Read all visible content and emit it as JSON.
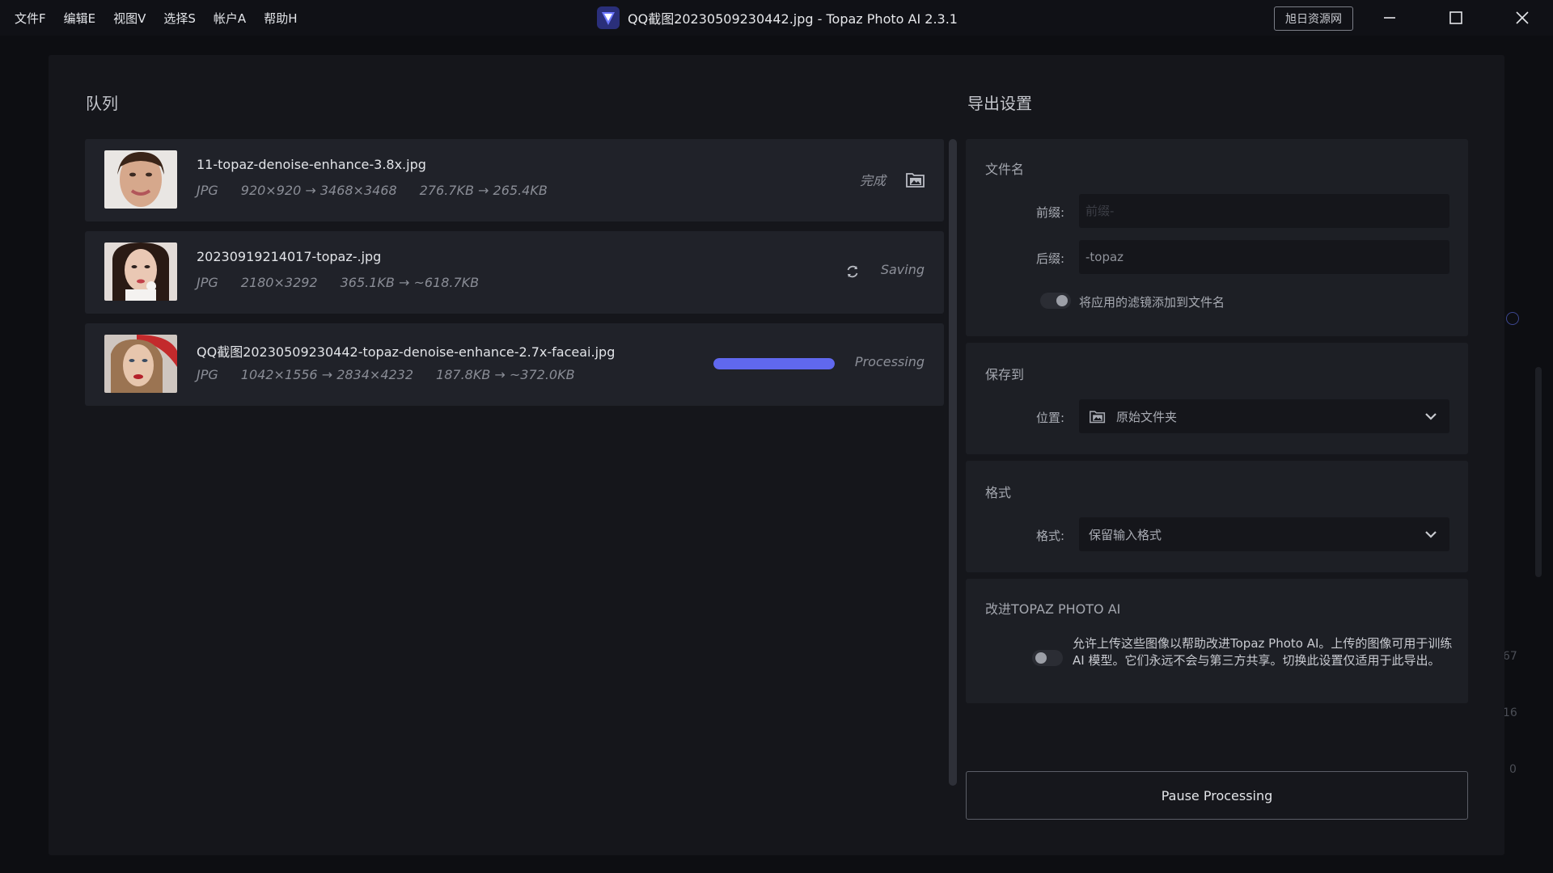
{
  "menu": [
    "文件F",
    "编辑E",
    "视图V",
    "选择S",
    "帐户A",
    "帮助H"
  ],
  "window": {
    "title": "QQ截图20230509230442.jpg - Topaz Photo AI 2.3.1",
    "badge": "旭日资源网"
  },
  "queue": {
    "title": "队列",
    "items": [
      {
        "filename": "11-topaz-denoise-enhance-3.8x.jpg",
        "format": "JPG",
        "dimensions": "920×920 → 3468×3468",
        "size": "276.7KB → 265.4KB",
        "status": "完成"
      },
      {
        "filename": "20230919214017-topaz-.jpg",
        "format": "JPG",
        "dimensions": "2180×3292",
        "size": "365.1KB → ~618.7KB",
        "status": "Saving"
      },
      {
        "filename": "QQ截图20230509230442-topaz-denoise-enhance-2.7x-faceai.jpg",
        "format": "JPG",
        "dimensions": "1042×1556 → 2834×4232",
        "size": "187.8KB → ~372.0KB",
        "status": "Processing",
        "progress": 1.0
      }
    ]
  },
  "export": {
    "title": "导出设置",
    "filename_section": {
      "label": "文件名",
      "prefix_label": "前缀:",
      "prefix_value": "",
      "prefix_placeholder": "前缀-",
      "suffix_label": "后缀:",
      "suffix_value": "-topaz",
      "filter_toggle_label": "将应用的滤镜添加到文件名"
    },
    "save_section": {
      "label": "保存到",
      "location_label": "位置:",
      "location_value": "原始文件夹"
    },
    "format_section": {
      "label": "格式",
      "format_label": "格式:",
      "format_value": "保留输入格式"
    },
    "improve_section": {
      "label": "改进TOPAZ PHOTO AI",
      "text": "允许上传这些图像以帮助改进Topaz Photo AI。上传的图像可用于训练 AI 模型。它们永远不会与第三方共享。切换此设置仅适用于此导出。"
    },
    "pause_button": "Pause Processing"
  },
  "background_edge": [
    "67",
    "16",
    "0"
  ],
  "colors": {
    "accent": "#6068ee",
    "panel": "#1d1f25",
    "item": "#202229"
  }
}
